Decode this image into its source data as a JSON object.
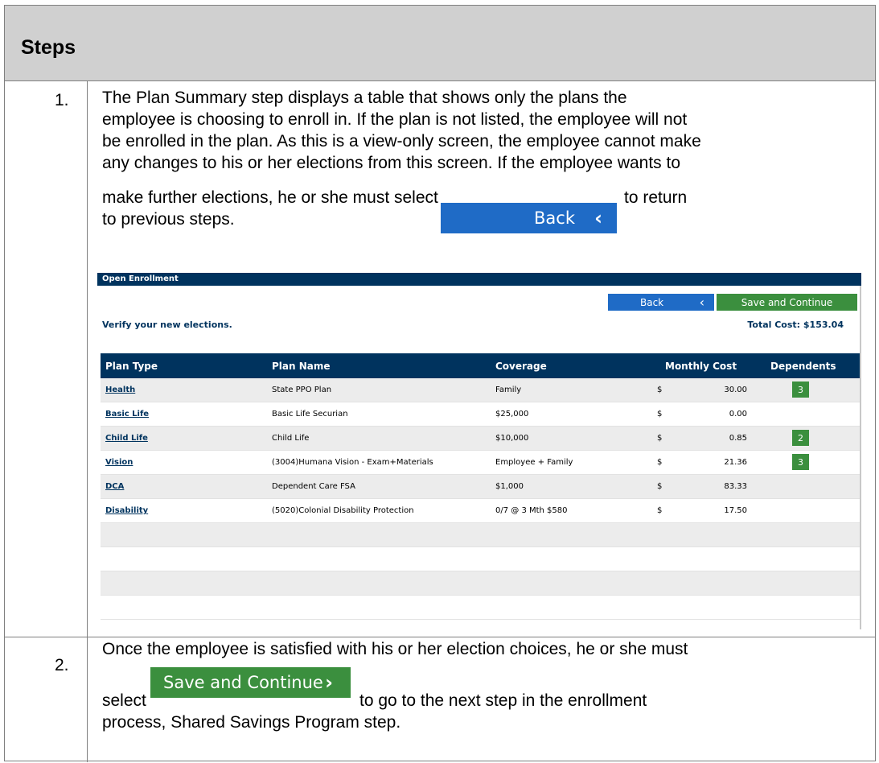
{
  "header": {
    "title": "Steps"
  },
  "step1": {
    "number": "1.",
    "lines": [
      "The Plan Summary step displays a table that shows only the plans the",
      "employee is choosing to enroll in. If the plan is not listed, the employee will not",
      "be enrolled in the plan. As this is a view-only screen, the employee cannot make",
      "any changes to his or her elections from this screen. If the employee wants to"
    ],
    "line5_before": "make further elections, he or she must select",
    "line5_after": "to return",
    "line6": "to previous steps.",
    "back_label": "Back",
    "back_icon": "chevron-left-icon"
  },
  "screenshot": {
    "bar_title": "Open Enrollment",
    "back_label": "Back",
    "save_label": "Save and Continue",
    "verify_text": "Verify your new elections.",
    "total_cost": "Total Cost: $153.04",
    "columns": [
      "Plan Type",
      "Plan Name",
      "Coverage",
      "Monthly Cost",
      "Dependents"
    ],
    "rows": [
      {
        "type": "Health",
        "name": "State PPO Plan",
        "coverage": "Family",
        "currency": "$",
        "cost": "30.00",
        "dependents": "3"
      },
      {
        "type": "Basic Life",
        "name": "Basic Life Securian",
        "coverage": "$25,000",
        "currency": "$",
        "cost": "0.00",
        "dependents": ""
      },
      {
        "type": "Child Life",
        "name": "Child Life",
        "coverage": "$10,000",
        "currency": "$",
        "cost": "0.85",
        "dependents": "2"
      },
      {
        "type": "Vision",
        "name": "(3004)Humana Vision - Exam+Materials",
        "coverage": "Employee + Family",
        "currency": "$",
        "cost": "21.36",
        "dependents": "3"
      },
      {
        "type": "DCA",
        "name": "Dependent Care FSA",
        "coverage": "$1,000",
        "currency": "$",
        "cost": "83.33",
        "dependents": ""
      },
      {
        "type": "Disability",
        "name": "(5020)Colonial Disability Protection",
        "coverage": "0/7 @ 3 Mth $580",
        "currency": "$",
        "cost": "17.50",
        "dependents": ""
      }
    ],
    "empty_rows": 4
  },
  "step2": {
    "number": "2.",
    "line1": "Once the employee is satisfied with his or her election choices, he or she must",
    "line2_before": "select",
    "line2_after": "to go to the next step in the enrollment",
    "line3": "process, Shared Savings Program step.",
    "save_label": "Save and Continue",
    "save_icon": "chevron-right-icon"
  },
  "colors": {
    "header_bg": "#d0d0d0",
    "navy": "#00335e",
    "back_blue": "#1f6bc6",
    "save_green": "#3b8f3e"
  }
}
